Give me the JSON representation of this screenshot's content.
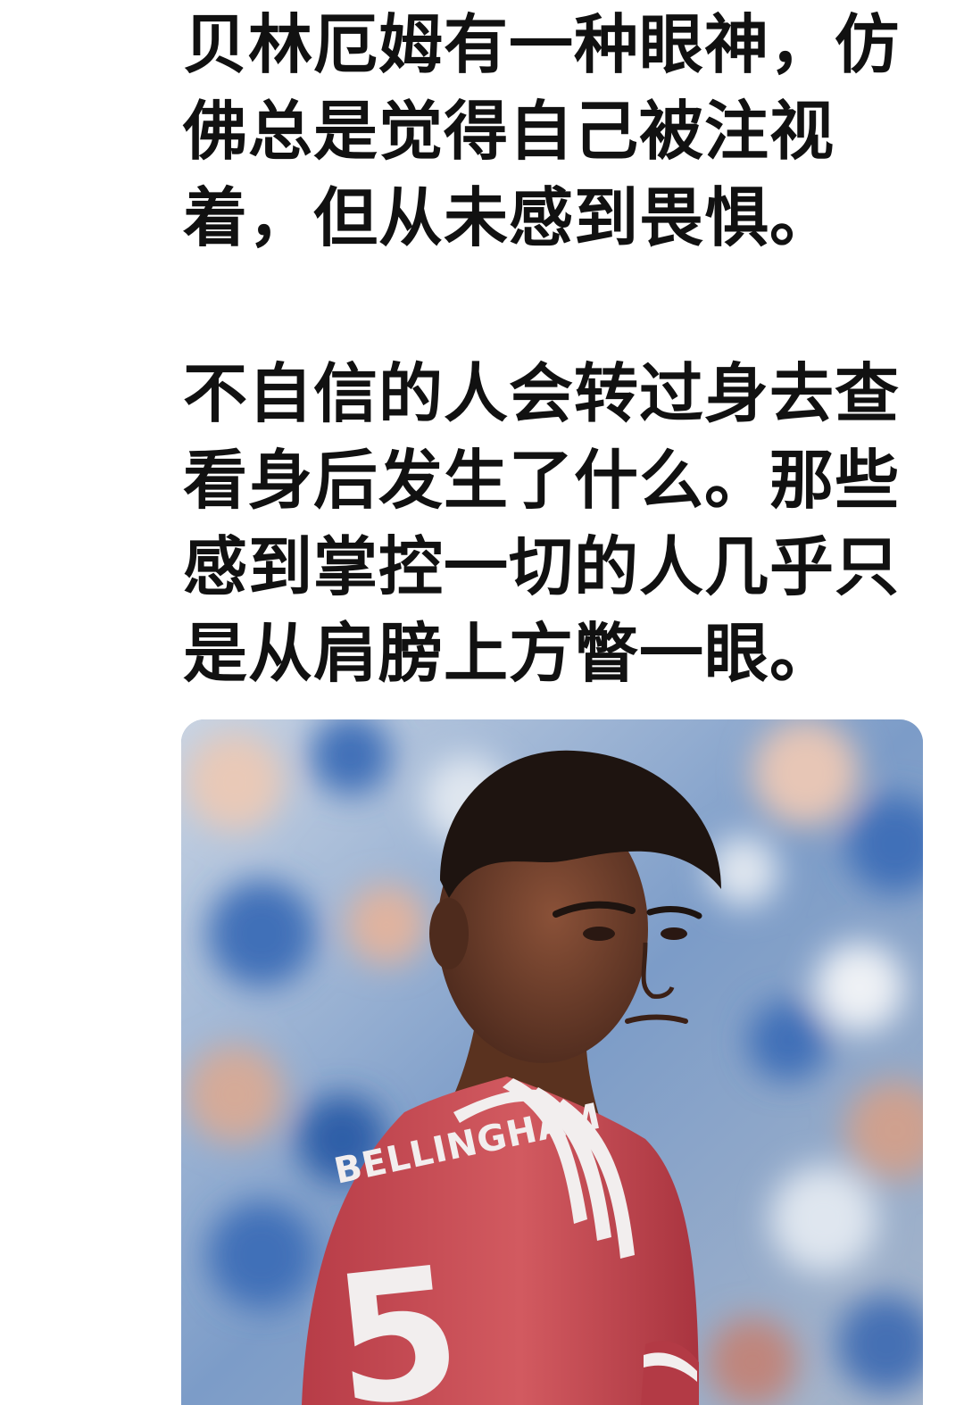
{
  "post": {
    "paragraphs": [
      "贝林厄姆有一种眼神，仿\n佛总是觉得自己被注视\n着，但从未感到畏惧。",
      "不自信的人会转过身去查\n看身后发生了什么。那些\n感到掌控一切的人几乎只\n是从肩膀上方瞥一眼。"
    ]
  },
  "photo": {
    "shirt_name": "BELLINGHAM",
    "shirt_number": "5",
    "colors": {
      "shirt": "#c7464f",
      "stripes": "#f2eeee",
      "skin": "#6b3d2b",
      "hair": "#1e1410",
      "crowd_blue": "#3f6fb8",
      "crowd_light": "#dfe6ef"
    }
  }
}
